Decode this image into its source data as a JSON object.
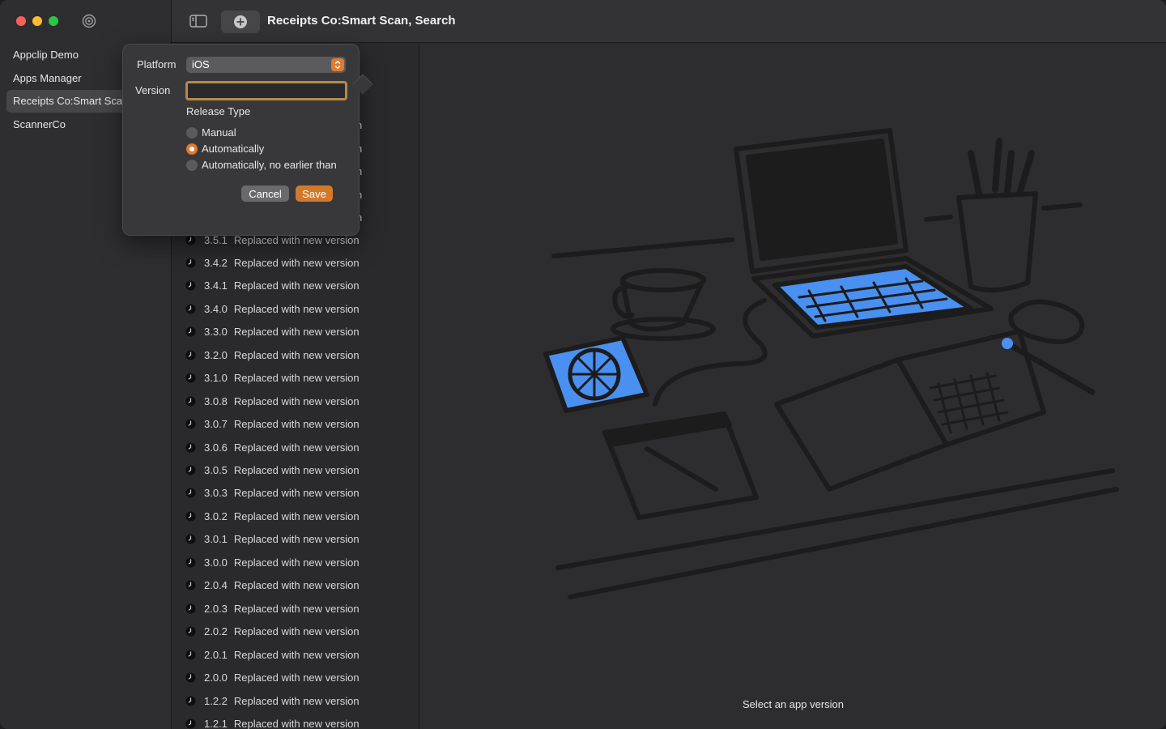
{
  "window": {
    "title": "Receipts Co:Smart Scan, Search"
  },
  "sidebar": {
    "items": [
      {
        "label": "Appclip Demo"
      },
      {
        "label": "Apps Manager"
      },
      {
        "label": "Receipts Co:Smart Scan, Search",
        "selected": true
      },
      {
        "label": "ScannerCo"
      }
    ]
  },
  "popover": {
    "platform_label": "Platform",
    "platform_value": "iOS",
    "version_label": "Version",
    "version_value": "",
    "release_type_label": "Release Type",
    "release_options": [
      {
        "label": "Manual",
        "checked": false
      },
      {
        "label": "Automatically",
        "checked": true
      },
      {
        "label": "Automatically, no earlier than",
        "checked": false
      }
    ],
    "cancel_label": "Cancel",
    "save_label": "Save"
  },
  "versions": {
    "hidden_suffix": "n",
    "rows": [
      {
        "version": "3.5.1",
        "status": "Replaced with new version"
      },
      {
        "version": "3.4.2",
        "status": "Replaced with new version"
      },
      {
        "version": "3.4.1",
        "status": "Replaced with new version"
      },
      {
        "version": "3.4.0",
        "status": "Replaced with new version"
      },
      {
        "version": "3.3.0",
        "status": "Replaced with new version"
      },
      {
        "version": "3.2.0",
        "status": "Replaced with new version"
      },
      {
        "version": "3.1.0",
        "status": "Replaced with new version"
      },
      {
        "version": "3.0.8",
        "status": "Replaced with new version"
      },
      {
        "version": "3.0.7",
        "status": "Replaced with new version"
      },
      {
        "version": "3.0.6",
        "status": "Replaced with new version"
      },
      {
        "version": "3.0.5",
        "status": "Replaced with new version"
      },
      {
        "version": "3.0.3",
        "status": "Replaced with new version"
      },
      {
        "version": "3.0.2",
        "status": "Replaced with new version"
      },
      {
        "version": "3.0.1",
        "status": "Replaced with new version"
      },
      {
        "version": "3.0.0",
        "status": "Replaced with new version"
      },
      {
        "version": "2.0.4",
        "status": "Replaced with new version"
      },
      {
        "version": "2.0.3",
        "status": "Replaced with new version"
      },
      {
        "version": "2.0.2",
        "status": "Replaced with new version"
      },
      {
        "version": "2.0.1",
        "status": "Replaced with new version"
      },
      {
        "version": "2.0.0",
        "status": "Replaced with new version"
      },
      {
        "version": "1.2.2",
        "status": "Replaced with new version"
      },
      {
        "version": "1.2.1",
        "status": "Replaced with new version"
      }
    ]
  },
  "detail": {
    "placeholder": "Select an app version"
  },
  "colors": {
    "accent": "#e07a2f",
    "illustration_highlight": "#4a90f0"
  },
  "icons": {
    "toolbar_sidebar": "sidebar-left-icon",
    "toolbar_add": "plus-circle-icon",
    "sidebar_header": "target-icon",
    "row_status": "clock-icon"
  }
}
